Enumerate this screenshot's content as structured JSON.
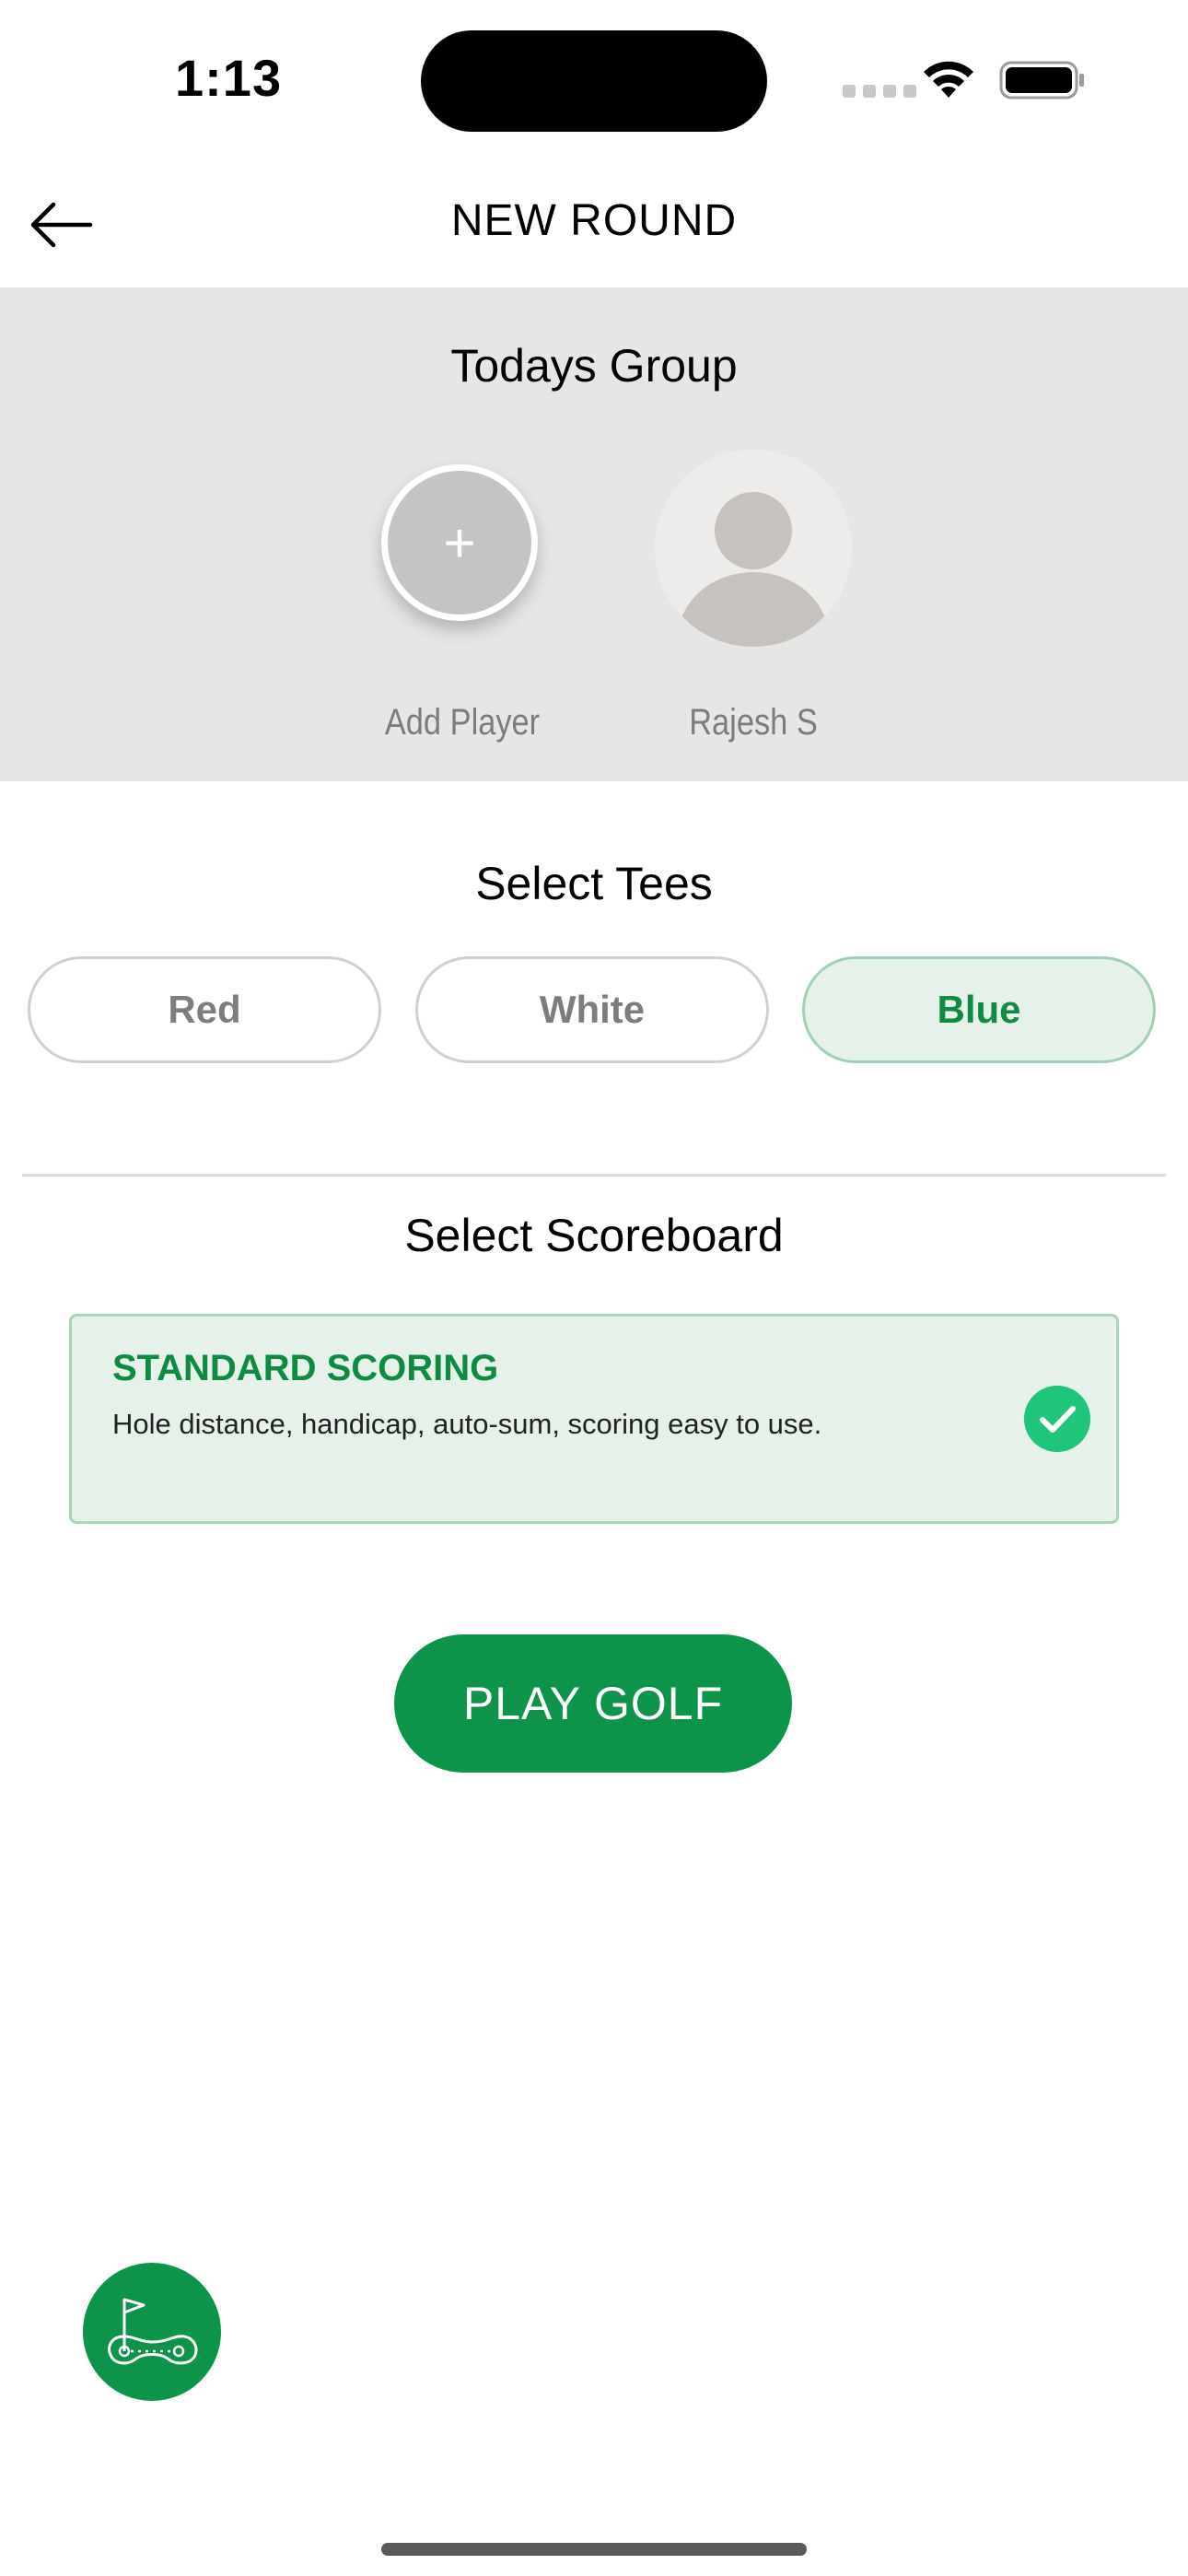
{
  "status_bar": {
    "time": "1:13"
  },
  "header": {
    "title": "NEW ROUND",
    "back_icon": "arrow-left-icon"
  },
  "group": {
    "title": "Todays Group",
    "add_player_symbol": "+",
    "add_player_label": "Add Player",
    "players": [
      {
        "name": "Rajesh S"
      }
    ]
  },
  "tees": {
    "title": "Select Tees",
    "options": [
      "Red",
      "White",
      "Blue"
    ],
    "selected": "Blue"
  },
  "scoreboard": {
    "title": "Select Scoreboard",
    "card_title": "STANDARD SCORING",
    "card_description": "Hole distance, handicap, auto-sum, scoring easy to use.",
    "selected": true
  },
  "play_button": {
    "label": "PLAY GOLF"
  },
  "colors": {
    "brand_green": "#0e944a",
    "selected_text_green": "#0e8a43",
    "check_green": "#1fc57a",
    "selected_bg": "#e6f1ea",
    "group_bg": "#e6e6e6"
  }
}
